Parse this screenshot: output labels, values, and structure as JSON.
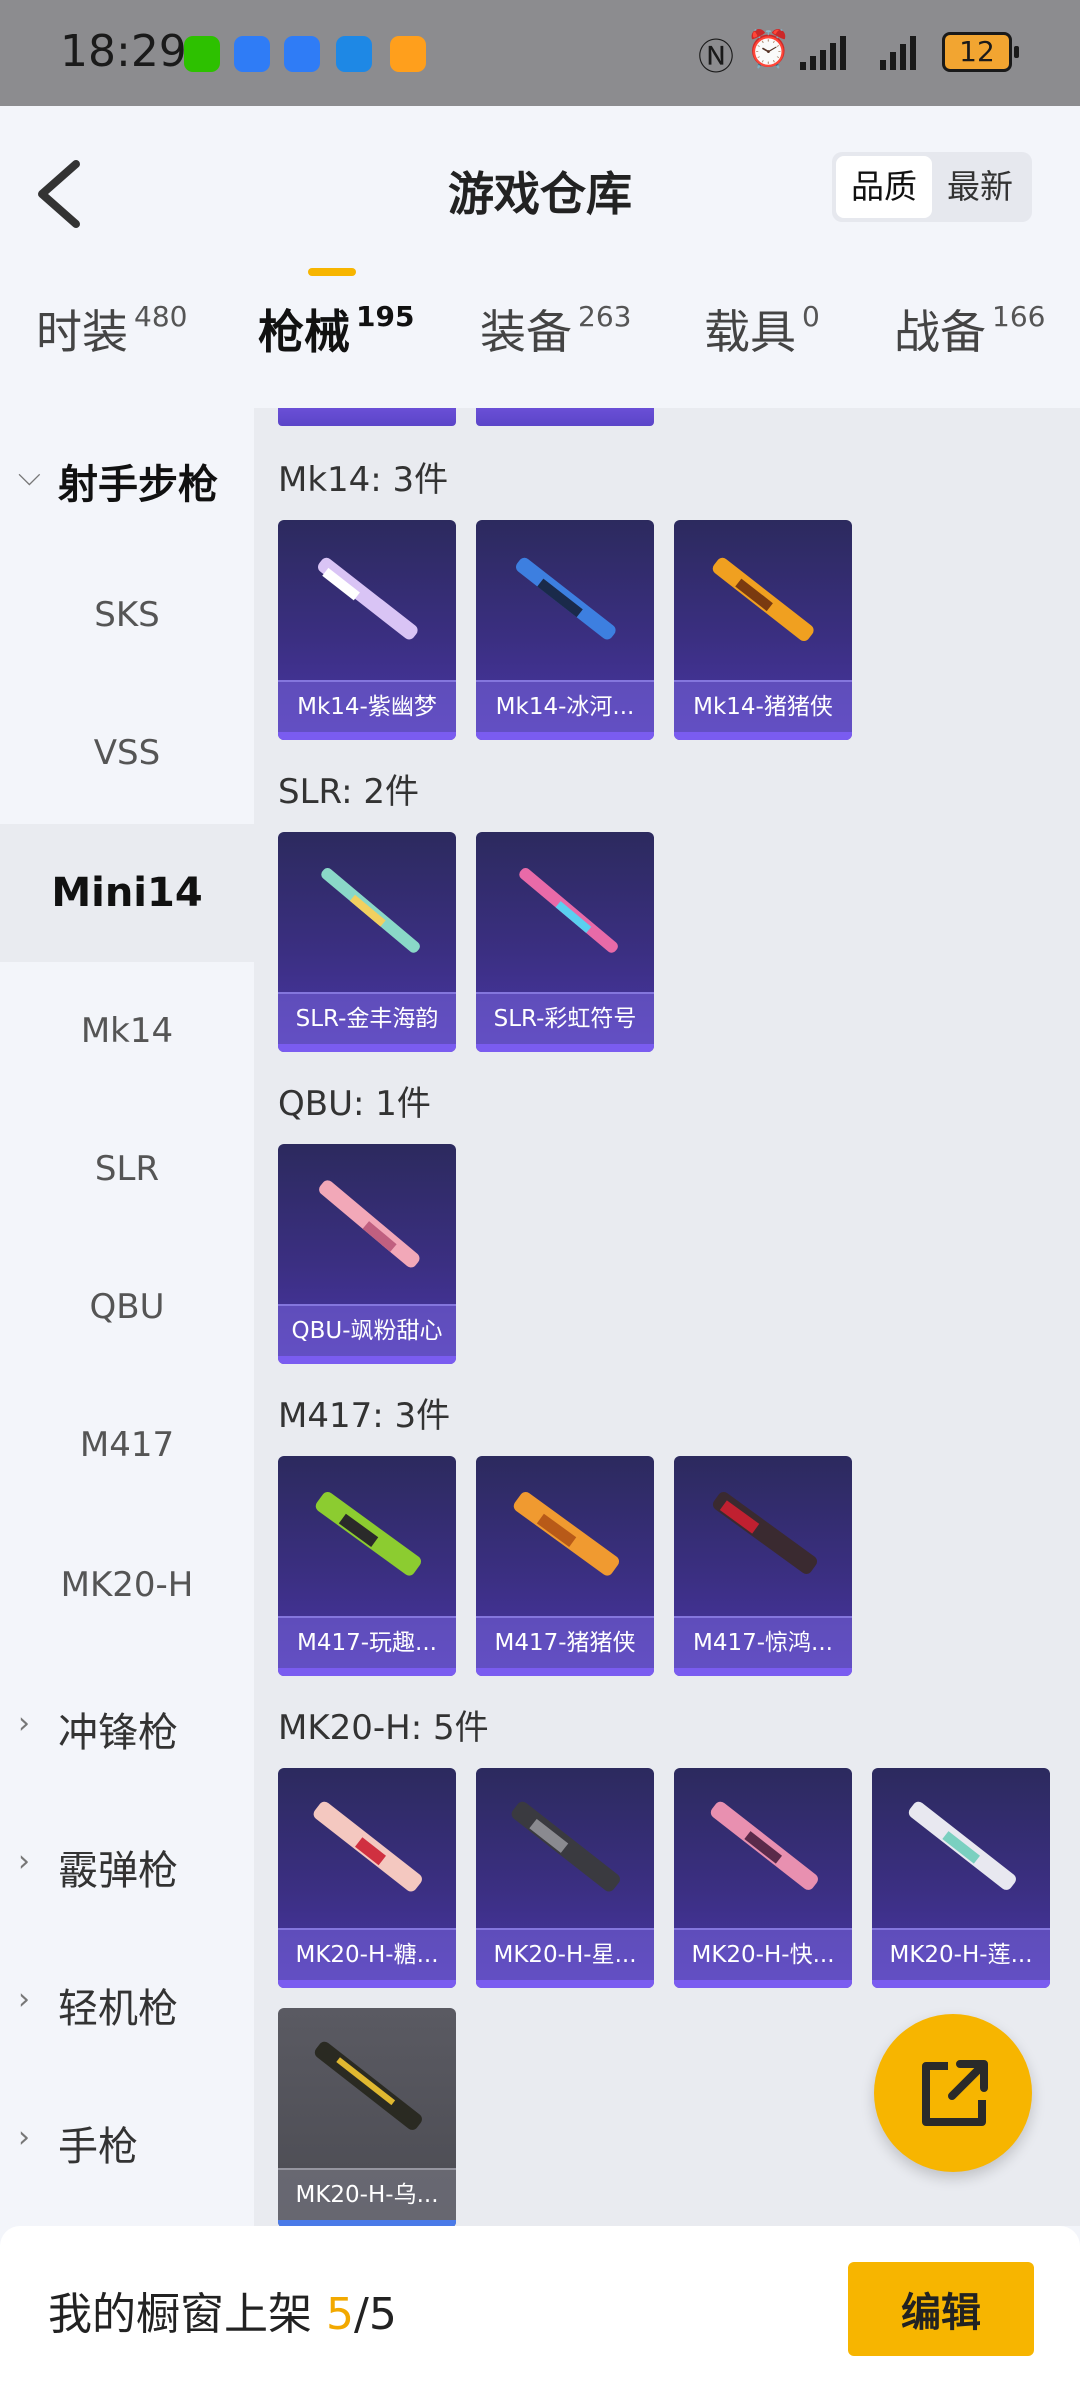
{
  "status_bar": {
    "time": "18:29",
    "battery": "12"
  },
  "header": {
    "title": "游戏仓库",
    "sort_options": [
      "品质",
      "最新"
    ],
    "sort_active": "品质"
  },
  "tabs": [
    {
      "label": "时装",
      "count": "480"
    },
    {
      "label": "枪械",
      "count": "195"
    },
    {
      "label": "装备",
      "count": "263"
    },
    {
      "label": "载具",
      "count": "0"
    },
    {
      "label": "战备",
      "count": "166"
    }
  ],
  "active_tab": "枪械",
  "sidebar": {
    "open_category": "射手步枪",
    "subitems": [
      "SKS",
      "VSS",
      "Mini14",
      "Mk14",
      "SLR",
      "QBU",
      "M417",
      "MK20-H"
    ],
    "active_subitem": "Mini14",
    "collapsed_categories": [
      "冲锋枪",
      "霰弹枪",
      "轻机枪",
      "手枪"
    ]
  },
  "groups": [
    {
      "title": "Mk14: 3件",
      "items": [
        "Mk14-紫幽梦",
        "Mk14-冰河...",
        "Mk14-猪猪侠"
      ]
    },
    {
      "title": "SLR: 2件",
      "items": [
        "SLR-金丰海韵",
        "SLR-彩虹符号"
      ]
    },
    {
      "title": "QBU: 1件",
      "items": [
        "QBU-飒粉甜心"
      ]
    },
    {
      "title": "M417: 3件",
      "items": [
        "M417-玩趣...",
        "M417-猪猪侠",
        "M417-惊鸿..."
      ]
    },
    {
      "title": "MK20-H: 5件",
      "items": [
        "MK20-H-糖...",
        "MK20-H-星...",
        "MK20-H-快...",
        "MK20-H-莲...",
        "MK20-H-乌..."
      ]
    }
  ],
  "bottom_bar": {
    "label": "我的橱窗上架",
    "current": "5",
    "total": "/5",
    "edit_label": "编辑"
  },
  "colors": {
    "accent": "#f7b500",
    "card_purple": "#3b2f82",
    "card_grey": "#5a5a62"
  }
}
